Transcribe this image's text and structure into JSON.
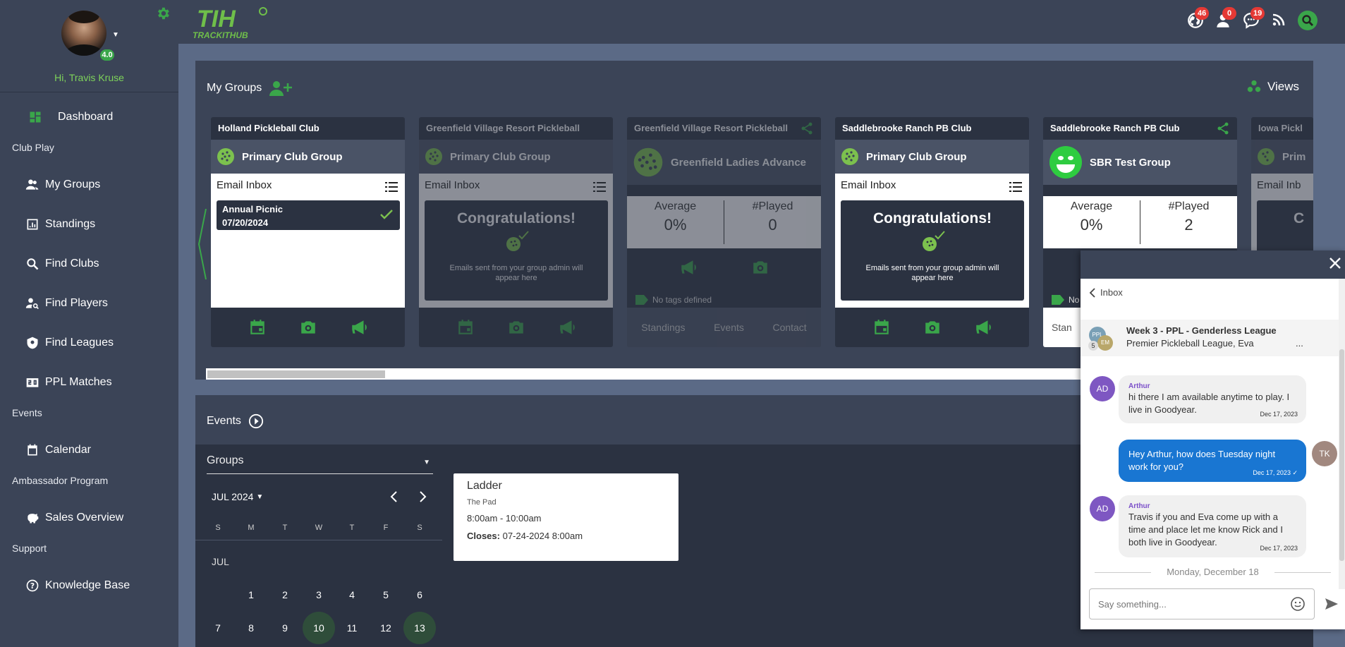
{
  "user": {
    "greeting": "Hi, Travis Kruse",
    "rating": "4.0"
  },
  "sidebar": {
    "dashboard": "Dashboard",
    "section_club_play": "Club Play",
    "my_groups": "My Groups",
    "standings": "Standings",
    "find_clubs": "Find Clubs",
    "find_players": "Find Players",
    "find_leagues": "Find Leagues",
    "ppl_matches": "PPL Matches",
    "section_events": "Events",
    "calendar": "Calendar",
    "section_ambassador": "Ambassador Program",
    "sales_overview": "Sales Overview",
    "section_support": "Support",
    "knowledge_base": "Knowledge Base"
  },
  "logo": {
    "letters": "TIH",
    "name": "TRACKITHUB"
  },
  "topbar": {
    "badge_globe": "46",
    "badge_user": "0",
    "badge_chat": "19"
  },
  "groups": {
    "title": "My Groups",
    "views": "Views",
    "cards": [
      {
        "club": "Holland Pickleball Club",
        "group": "Primary Club Group",
        "inbox": "Email Inbox",
        "message_title": "Annual Picnic",
        "message_date": "07/20/2024"
      },
      {
        "club": "Greenfield Village Resort Pickleball",
        "group": "Primary Club Group",
        "inbox": "Email Inbox",
        "congrats": "Congratulations!",
        "note": "Emails sent from your group admin will appear here"
      },
      {
        "club": "Greenfield Village Resort Pickleball",
        "group": "Greenfield Ladies Advance",
        "avg_label": "Average",
        "avg": "0%",
        "played_label": "#Played",
        "played": "0",
        "tags": "No tags defined",
        "link1": "Standings",
        "link2": "Events",
        "link3": "Contact"
      },
      {
        "club": "Saddlebrooke Ranch PB Club",
        "group": "Primary Club Group",
        "inbox": "Email Inbox",
        "congrats": "Congratulations!",
        "note": "Emails sent from your group admin will appear here"
      },
      {
        "club": "Saddlebrooke Ranch PB Club",
        "group": "SBR Test Group",
        "avg_label": "Average",
        "avg": "0%",
        "played_label": "#Played",
        "played": "2",
        "tags": "No",
        "link1": "Stan"
      },
      {
        "club": "Iowa Pickl",
        "group": "Prim",
        "inbox": "Email Inb",
        "congrats": "C"
      }
    ]
  },
  "events": {
    "title": "Events",
    "select": "Groups",
    "month": "JUL 2024",
    "month_label": "JUL",
    "dow": [
      "S",
      "M",
      "T",
      "W",
      "T",
      "F",
      "S"
    ],
    "week1": [
      "1",
      "2",
      "3",
      "4",
      "5",
      "6"
    ],
    "week2": [
      "7",
      "8",
      "9",
      "10",
      "11",
      "12",
      "13"
    ],
    "event": {
      "title": "Ladder",
      "venue": "The Pad",
      "time": "8:00am - 10:00am",
      "closes_label": "Closes:",
      "closes": "07-24-2024 8:00am"
    }
  },
  "chat": {
    "back": "Inbox",
    "thread_name": "Week 3 - PPL - Genderless League",
    "thread_members": "Premier Pickleball League, Eva",
    "more": "...",
    "thread_av1": "PPL",
    "thread_av2": "EM",
    "thread_count": "5",
    "messages": [
      {
        "initials": "AD",
        "who": "Arthur",
        "text": "hi there I am available anytime to play.  I live in Goodyear.",
        "time": "Dec 17, 2023"
      },
      {
        "initials": "TK",
        "text": "Hey Arthur, how does Tuesday night work for you?",
        "time": "Dec 17, 2023 ✓"
      },
      {
        "initials": "AD",
        "who": "Arthur",
        "text": "Travis if you and  Eva come up with a time and place let me know Rick and I both live in Goodyear.",
        "time": "Dec 17, 2023"
      }
    ],
    "date_sep": "Monday, December 18",
    "placeholder": "Say something..."
  },
  "colors": {
    "accent": "#7ed35a",
    "sidebar": "#3b4457",
    "content": "#5b6a86",
    "badge": "#e53935",
    "chat_out": "#1976d2"
  }
}
